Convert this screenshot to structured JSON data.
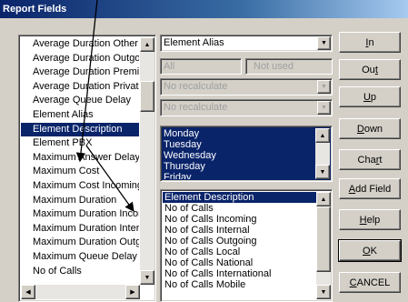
{
  "window": {
    "title": "Report Fields"
  },
  "left_list": {
    "items": [
      "Average Duration Other",
      "Average Duration Outgo",
      "Average Duration Premi",
      "Average Duration Privat",
      "Average Queue Delay",
      "Element Alias",
      "Element Description",
      "Element PBX",
      "Maximum Answer Delay",
      "Maximum Cost",
      "Maximum Cost Incoming",
      "Maximum Duration",
      "Maximum Duration Incor",
      "Maximum Duration Interr",
      "Maximum Duration Outg",
      "Maximum Queue Delay",
      "No of Calls"
    ],
    "selected": "Element Description"
  },
  "controls": {
    "alias_combo": "Element Alias",
    "filter_all": "All",
    "filter_not_used": "Not used",
    "recalc_1": "No recalculate",
    "recalc_2": "No recalculate"
  },
  "day_list": {
    "items": [
      "Monday",
      "Tuesday",
      "Wednesday",
      "Thursday",
      "Friday"
    ]
  },
  "field_list": {
    "items": [
      "Element Description",
      "No of Calls",
      "No of Calls Incoming",
      "No of Calls Internal",
      "No of Calls Outgoing",
      "No of Calls Local",
      "No of Calls National",
      "No of Calls International",
      "No of Calls Mobile"
    ],
    "selected": "Element Description"
  },
  "buttons": {
    "in": {
      "pre": "",
      "key": "I",
      "post": "n"
    },
    "out": {
      "pre": "Ou",
      "key": "t",
      "post": ""
    },
    "up": {
      "pre": "",
      "key": "U",
      "post": "p"
    },
    "down": {
      "pre": "",
      "key": "D",
      "post": "own"
    },
    "chart": {
      "pre": "Cha",
      "key": "r",
      "post": "t"
    },
    "add_field": {
      "pre": "",
      "key": "A",
      "post": "dd Field"
    },
    "help": {
      "pre": "",
      "key": "H",
      "post": "elp"
    },
    "ok": {
      "pre": "",
      "key": "O",
      "post": "K"
    },
    "cancel": {
      "pre": "",
      "key": "C",
      "post": "ANCEL"
    }
  }
}
